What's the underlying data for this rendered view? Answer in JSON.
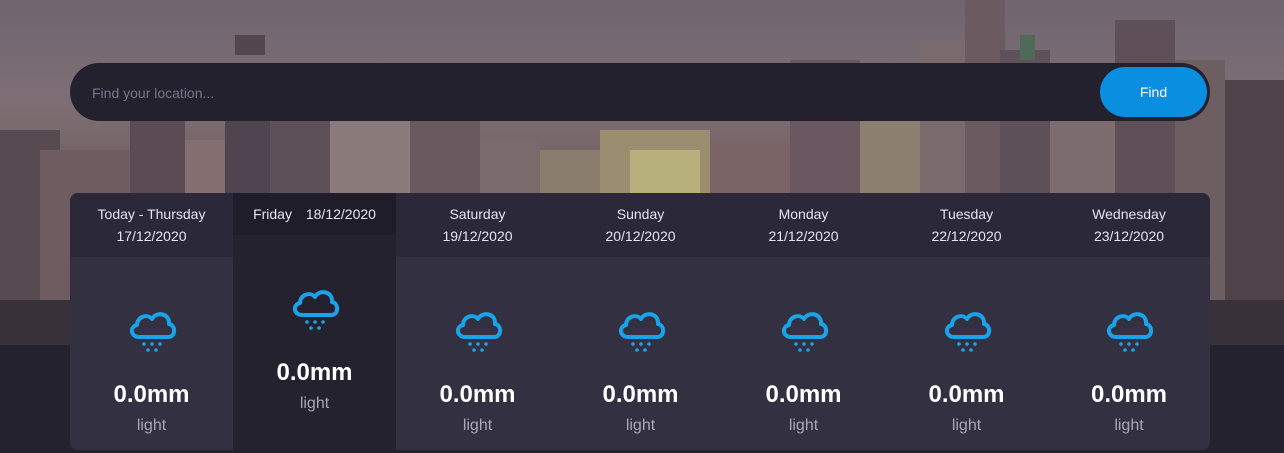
{
  "search": {
    "placeholder": "Find your location...",
    "button_label": "Find"
  },
  "forecast": [
    {
      "day": "Today - Thursday",
      "date": "17/12/2020",
      "amount": "0.0mm",
      "desc": "light",
      "icon": "snow-cloud-icon"
    },
    {
      "day": "Friday",
      "date": "18/12/2020",
      "amount": "0.0mm",
      "desc": "light",
      "icon": "snow-cloud-icon"
    },
    {
      "day": "Saturday",
      "date": "19/12/2020",
      "amount": "0.0mm",
      "desc": "light",
      "icon": "snow-cloud-icon"
    },
    {
      "day": "Sunday",
      "date": "20/12/2020",
      "amount": "0.0mm",
      "desc": "light",
      "icon": "snow-cloud-icon"
    },
    {
      "day": "Monday",
      "date": "21/12/2020",
      "amount": "0.0mm",
      "desc": "light",
      "icon": "snow-cloud-icon"
    },
    {
      "day": "Tuesday",
      "date": "22/12/2020",
      "amount": "0.0mm",
      "desc": "light",
      "icon": "snow-cloud-icon"
    },
    {
      "day": "Wednesday",
      "date": "23/12/2020",
      "amount": "0.0mm",
      "desc": "light",
      "icon": "snow-cloud-icon"
    }
  ],
  "colors": {
    "accent": "#0a8ee0",
    "icon": "#1aa3e8",
    "panel": "#323041",
    "active_panel": "#24222f"
  }
}
